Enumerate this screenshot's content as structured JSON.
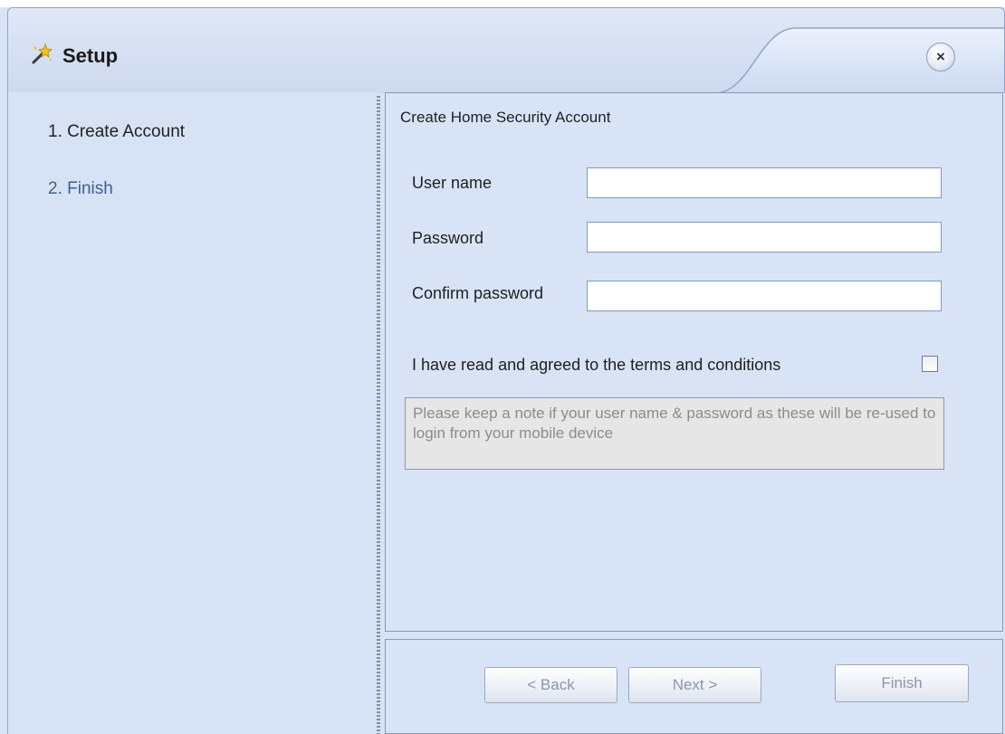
{
  "window": {
    "title": "Setup",
    "close_glyph": "×"
  },
  "icons": {
    "app": "setup-wand-icon",
    "close": "close-icon"
  },
  "steps": [
    {
      "label": "1. Create Account",
      "state": "current"
    },
    {
      "label": "2. Finish",
      "state": "pending"
    }
  ],
  "form": {
    "title": "Create Home Security Account",
    "username_label": "User name",
    "username_value": "",
    "password_label": "Password",
    "password_value": "",
    "confirm_label": "Confirm password",
    "confirm_value": "",
    "terms_label": "I have read and agreed to the terms and conditions",
    "terms_checked": false,
    "note": "Please keep a note if your user name & password as these will be re-used to login from your mobile device"
  },
  "buttons": {
    "back": "< Back",
    "next": "Next >",
    "finish": "Finish"
  },
  "colors": {
    "window_bg": "#d7e2f5",
    "step_pending": "#3f5e8e",
    "disabled_text": "#8d96a6"
  }
}
